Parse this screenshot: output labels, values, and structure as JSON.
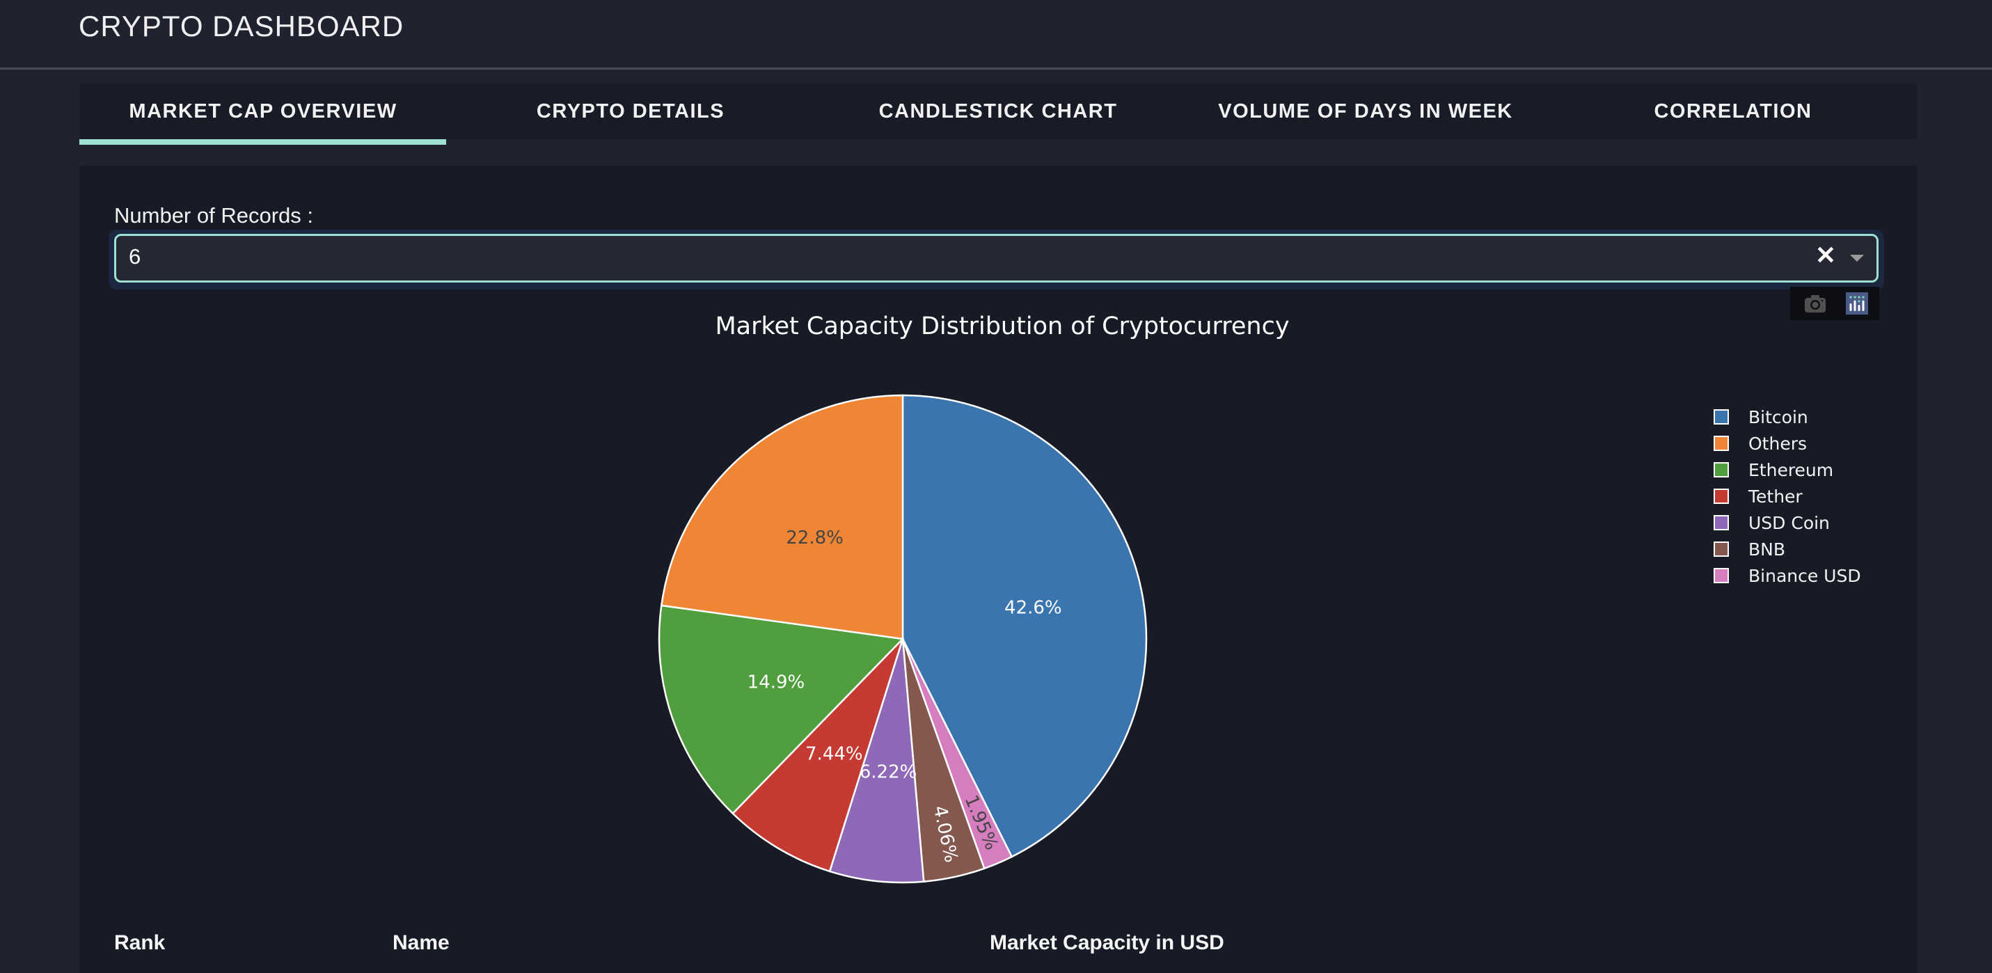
{
  "app": {
    "title": "CRYPTO DASHBOARD"
  },
  "tabs": [
    {
      "label": "MARKET CAP OVERVIEW",
      "active": true
    },
    {
      "label": "CRYPTO DETAILS",
      "active": false
    },
    {
      "label": "CANDLESTICK CHART",
      "active": false
    },
    {
      "label": "VOLUME OF DAYS IN WEEK",
      "active": false
    },
    {
      "label": "CORRELATION",
      "active": false
    }
  ],
  "controls": {
    "records_label": "Number of Records :",
    "records_value": "6",
    "clear_icon": "close-icon",
    "dropdown_icon": "caret-down-icon"
  },
  "modebar": {
    "buttons": [
      {
        "name": "download-plot-icon",
        "title": "Download plot as a png"
      },
      {
        "name": "plotly-logo-icon",
        "title": "Produced with Plotly"
      }
    ]
  },
  "colors": {
    "accent": "#a0e0d5",
    "background": "#20222f",
    "panel": "#181b26"
  },
  "chart_data": {
    "type": "pie",
    "title": "Market Capacity Distribution of Cryptocurrency",
    "direction": "clockwise",
    "start": "top",
    "legend_position": "top-right",
    "slices": [
      {
        "label": "Bitcoin",
        "percent": 42.6,
        "text": "42.6%",
        "color": "#3b75af",
        "text_color": "#ffffff"
      },
      {
        "label": "Others",
        "percent": 22.8,
        "text": "22.8%",
        "color": "#ef8636",
        "text_color": "#444444"
      },
      {
        "label": "Ethereum",
        "percent": 14.9,
        "text": "14.9%",
        "color": "#519e3e",
        "text_color": "#ffffff"
      },
      {
        "label": "Tether",
        "percent": 7.44,
        "text": "7.44%",
        "color": "#c53a32",
        "text_color": "#ffffff"
      },
      {
        "label": "USD Coin",
        "percent": 6.22,
        "text": "6.22%",
        "color": "#8d69b8",
        "text_color": "#ffffff"
      },
      {
        "label": "BNB",
        "percent": 4.06,
        "text": "4.06%",
        "color": "#84584e",
        "text_color": "#ffffff"
      },
      {
        "label": "Binance USD",
        "percent": 1.95,
        "text": "1.95%",
        "color": "#d57dbf",
        "text_color": "#444444"
      }
    ],
    "draw_order": [
      "Bitcoin",
      "Binance USD",
      "BNB",
      "USD Coin",
      "Tether",
      "Ethereum",
      "Others"
    ]
  },
  "table": {
    "headers": [
      "Rank",
      "Name",
      "Market Capacity in USD"
    ]
  }
}
